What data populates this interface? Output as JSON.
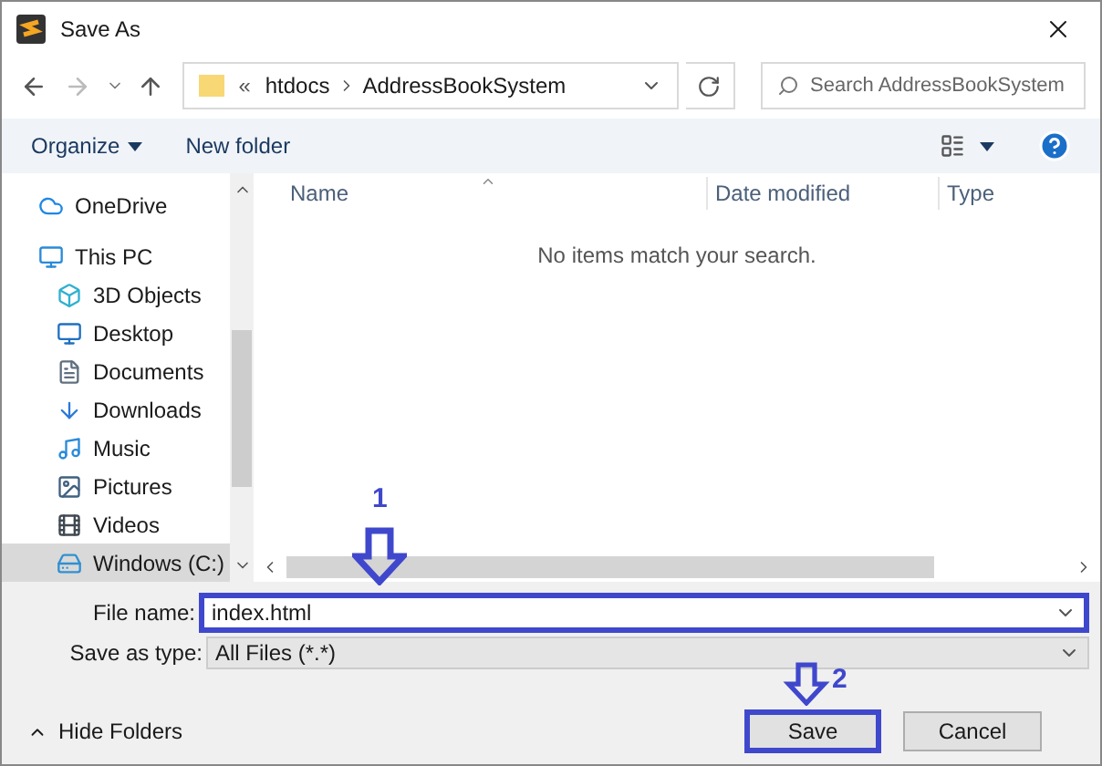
{
  "window": {
    "title": "Save As"
  },
  "address": {
    "overflow": "«",
    "crumbs": [
      "htdocs",
      "AddressBookSystem"
    ]
  },
  "search": {
    "placeholder": "Search AddressBookSystem"
  },
  "toolbar": {
    "organize": "Organize",
    "new_folder": "New folder"
  },
  "sidebar": {
    "items": [
      {
        "label": "OneDrive",
        "kind": "cloud",
        "selected": false
      },
      {
        "label": "This PC",
        "kind": "pc",
        "selected": false,
        "children": [
          {
            "label": "3D Objects",
            "kind": "cube",
            "selected": false
          },
          {
            "label": "Desktop",
            "kind": "desktop",
            "selected": false
          },
          {
            "label": "Documents",
            "kind": "doc",
            "selected": false
          },
          {
            "label": "Downloads",
            "kind": "download",
            "selected": false
          },
          {
            "label": "Music",
            "kind": "music",
            "selected": false
          },
          {
            "label": "Pictures",
            "kind": "pictures",
            "selected": false
          },
          {
            "label": "Videos",
            "kind": "video",
            "selected": false
          },
          {
            "label": "Windows (C:)",
            "kind": "drive",
            "selected": true
          }
        ]
      }
    ]
  },
  "table": {
    "columns": [
      "Name",
      "Date modified",
      "Type"
    ],
    "empty_message": "No items match your search."
  },
  "form": {
    "file_name_label": "File name:",
    "file_name": "index.html",
    "type_label": "Save as type:",
    "type_value": "All Files (*.*)"
  },
  "hide_folders": "Hide Folders",
  "buttons": [
    "Save",
    "Cancel"
  ],
  "annotations": [
    {
      "number": "1"
    },
    {
      "number": "2"
    }
  ]
}
